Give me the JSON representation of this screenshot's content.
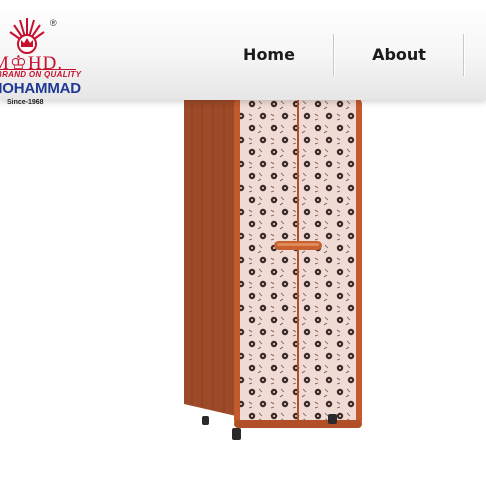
{
  "brand": {
    "logo_mark": "M♔HD.",
    "registered": "®",
    "tagline": "BRAND ON QUALITY",
    "name": "MOHAMMAD",
    "since": "Since-1968"
  },
  "nav": {
    "items": [
      {
        "label": "Home"
      },
      {
        "label": "About"
      }
    ]
  },
  "product": {
    "icon": "wardrobe-image"
  },
  "colors": {
    "brand_red": "#c8102e",
    "brand_blue": "#1f3a93",
    "wardrobe_wood": "#b9562c",
    "wardrobe_panel": "#f0dcd4",
    "flower_dark": "#3a2a2a"
  }
}
